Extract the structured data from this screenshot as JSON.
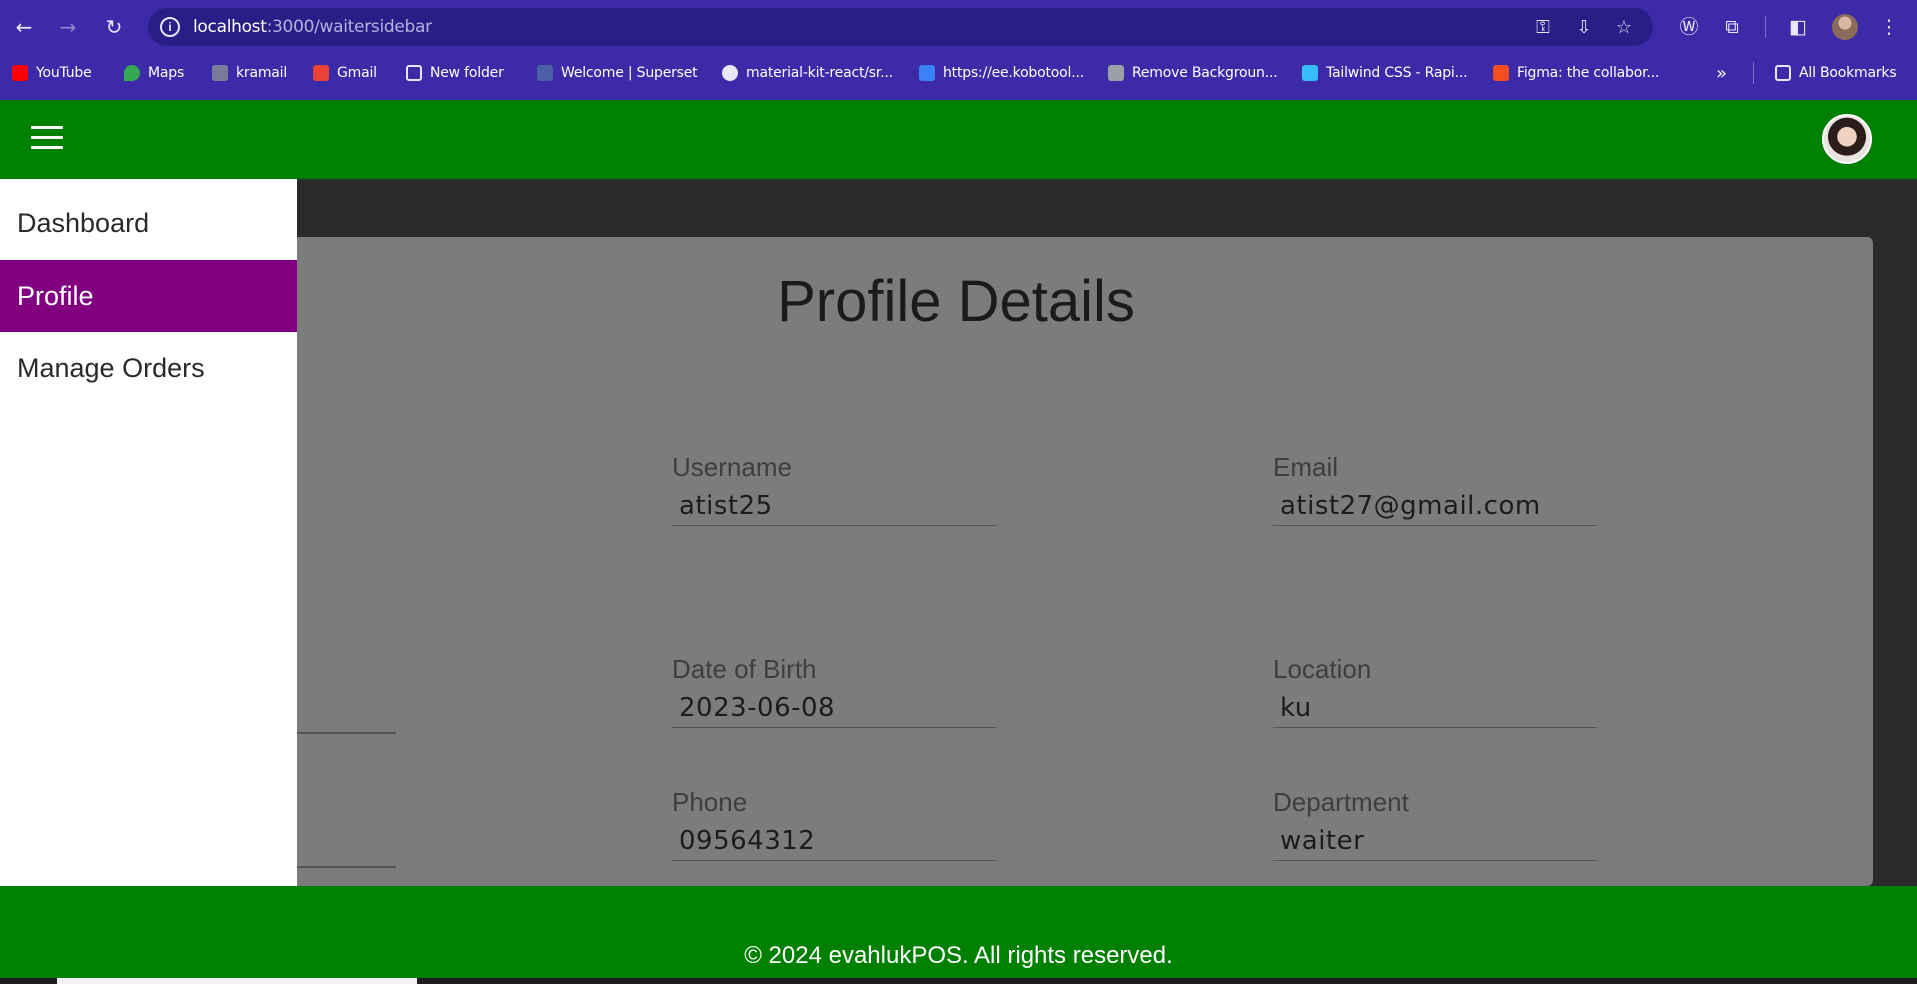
{
  "browser": {
    "url_host": "localhost",
    "url_rest": ":3000/waitersidebar",
    "bookmarks": [
      {
        "label": "YouTube",
        "color": "#ff0000"
      },
      {
        "label": "Maps",
        "color": "#34a853"
      },
      {
        "label": "kramail",
        "color": "#7a7a9a"
      },
      {
        "label": "Gmail",
        "color": "#ea4335"
      },
      {
        "label": "New folder",
        "color": "#e8e6f8"
      },
      {
        "label": "Welcome | Superset",
        "color": "#4a5fa8"
      },
      {
        "label": "material-kit-react/sr...",
        "color": "#e8e6f8"
      },
      {
        "label": "https://ee.kobotool...",
        "color": "#3b82f6"
      },
      {
        "label": "Remove Backgroun...",
        "color": "#9aa0a6"
      },
      {
        "label": "Tailwind CSS - Rapi...",
        "color": "#38bdf8"
      },
      {
        "label": "Figma: the collabor...",
        "color": "#f24e1e"
      }
    ],
    "all_bookmarks": "All Bookmarks"
  },
  "sidebar": {
    "items": [
      {
        "label": "Dashboard"
      },
      {
        "label": "Profile",
        "active": true
      },
      {
        "label": "Manage Orders"
      }
    ]
  },
  "profile": {
    "title": "Profile Details",
    "fields": {
      "username": {
        "label": "Username",
        "value": "atist25"
      },
      "email": {
        "label": "Email",
        "value": "atist27@gmail.com"
      },
      "dob": {
        "label": "Date of Birth",
        "value": "2023-06-08"
      },
      "location": {
        "label": "Location",
        "value": "ku"
      },
      "phone": {
        "label": "Phone",
        "value": "09564312"
      },
      "department": {
        "label": "Department",
        "value": "waiter"
      }
    }
  },
  "footer": {
    "text": "© 2024 evahlukPOS. All rights reserved."
  },
  "colors": {
    "chrome": "#3c2aa8",
    "header": "#008000",
    "active_item": "#800080"
  }
}
